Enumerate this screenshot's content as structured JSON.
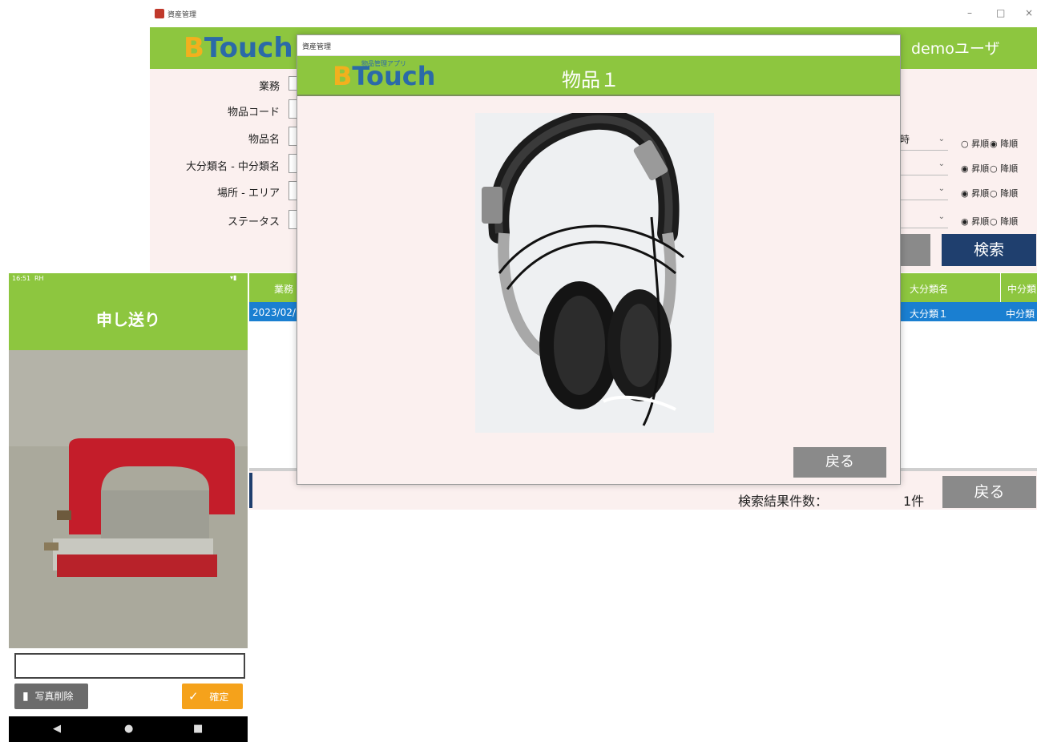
{
  "main_window": {
    "title": "資産管理",
    "controls": {
      "minimize": "–",
      "maximize": "□",
      "close": "×"
    },
    "logo": {
      "b": "B",
      "text": "Touch",
      "sub": "物品管理アプリ"
    },
    "user": "demoユーザ",
    "search_form": {
      "fields": [
        "業務",
        "物品コード",
        "物品名",
        "大分類名 - 中分類名",
        "場所 - エリア",
        "ステータス"
      ],
      "sort_rows": [
        {
          "select": "時",
          "asc": "昇順",
          "desc": "降順",
          "selected": "desc"
        },
        {
          "select": "",
          "asc": "昇順",
          "desc": "降順",
          "selected": "asc"
        },
        {
          "select": "",
          "asc": "昇順",
          "desc": "降順",
          "selected": "asc"
        },
        {
          "select": "",
          "asc": "昇順",
          "desc": "降順",
          "selected": "asc"
        }
      ],
      "search_button": "検索"
    },
    "table": {
      "headers": {
        "first": "業務",
        "major": "大分類名",
        "mid": "中分類"
      },
      "row": {
        "first": "2023/02/",
        "major": "大分類１",
        "mid": "中分類"
      }
    },
    "footer": {
      "result_label": "検索結果件数：",
      "result_count": "1件",
      "back_button": "戻る"
    }
  },
  "modal": {
    "window_title": "資産管理",
    "logo": {
      "b": "B",
      "text": "Touch",
      "sub": "物品管理アプリ"
    },
    "title": "物品１",
    "back_button": "戻る"
  },
  "phone": {
    "status_time": "16:51",
    "status_extra": "RH",
    "title": "申し送り",
    "input_value": "",
    "photo_delete_button": "写真削除",
    "confirm_button": "確定",
    "nav": {
      "back": "◀",
      "home": "●",
      "recent": "■"
    }
  },
  "colors": {
    "header_green": "#8dc63f",
    "navy": "#1f3f6e",
    "selected_row": "#1a7fd1",
    "gray_button": "#8a8a8a",
    "orange": "#f5a21b"
  }
}
